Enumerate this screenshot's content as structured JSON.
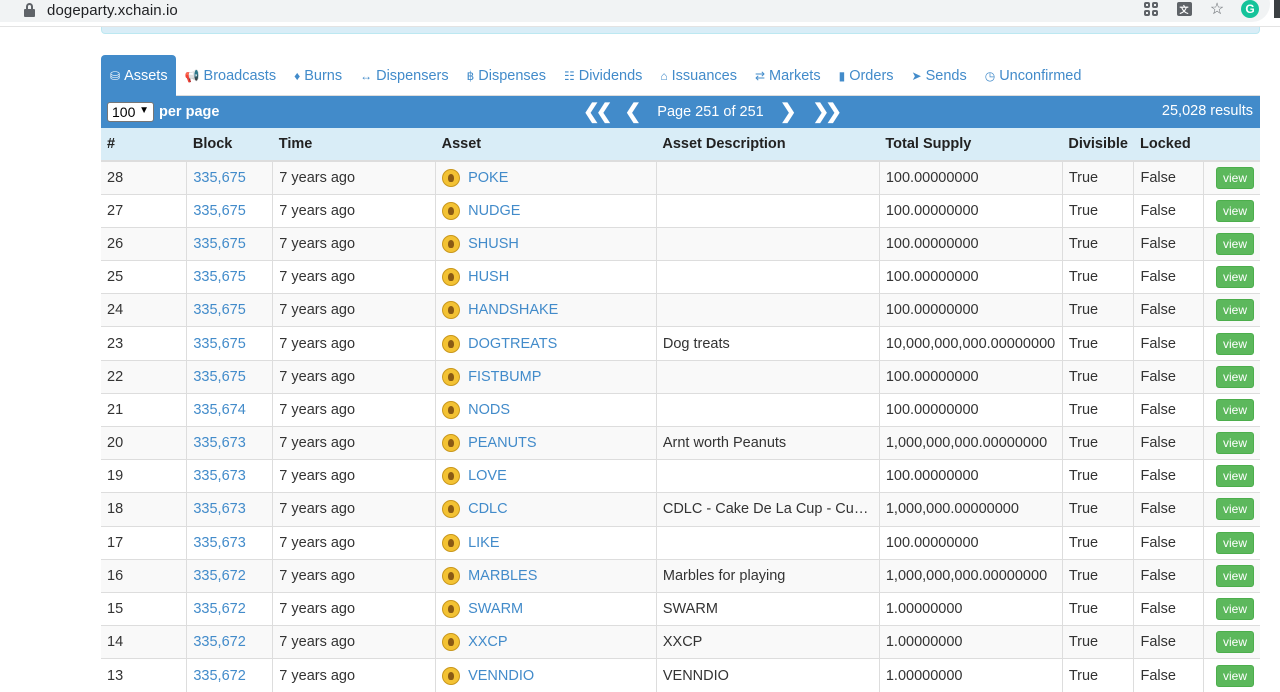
{
  "browser": {
    "url": "dogeparty.xchain.io",
    "icons": [
      "apps-icon",
      "translate-icon",
      "star-icon",
      "grammarly-icon"
    ]
  },
  "tabs": [
    {
      "label": "Assets",
      "icon": "coins-icon",
      "active": true
    },
    {
      "label": "Broadcasts",
      "icon": "bullhorn-icon"
    },
    {
      "label": "Burns",
      "icon": "fire-icon"
    },
    {
      "label": "Dispensers",
      "icon": "arrows-h-icon"
    },
    {
      "label": "Dispenses",
      "icon": "bitcoin-icon"
    },
    {
      "label": "Dividends",
      "icon": "sitemap-icon"
    },
    {
      "label": "Issuances",
      "icon": "bank-icon"
    },
    {
      "label": "Markets",
      "icon": "exchange-icon"
    },
    {
      "label": "Orders",
      "icon": "book-icon"
    },
    {
      "label": "Sends",
      "icon": "paper-plane-icon"
    },
    {
      "label": "Unconfirmed",
      "icon": "clock-icon"
    }
  ],
  "toolbar": {
    "per_page_value": "100",
    "per_page_label": "per page",
    "page_text": "Page 251 of 251",
    "results": "25,028 results"
  },
  "table": {
    "headers": [
      "#",
      "Block",
      "Time",
      "Asset",
      "Asset Description",
      "Total Supply",
      "Divisible",
      "Locked",
      ""
    ],
    "view_label": "view",
    "rows": [
      {
        "num": "28",
        "block": "335,675",
        "time": "7 years ago",
        "asset": "POKE",
        "desc": "",
        "supply": "100.00000000",
        "divisible": "True",
        "locked": "False"
      },
      {
        "num": "27",
        "block": "335,675",
        "time": "7 years ago",
        "asset": "NUDGE",
        "desc": "",
        "supply": "100.00000000",
        "divisible": "True",
        "locked": "False"
      },
      {
        "num": "26",
        "block": "335,675",
        "time": "7 years ago",
        "asset": "SHUSH",
        "desc": "",
        "supply": "100.00000000",
        "divisible": "True",
        "locked": "False"
      },
      {
        "num": "25",
        "block": "335,675",
        "time": "7 years ago",
        "asset": "HUSH",
        "desc": "",
        "supply": "100.00000000",
        "divisible": "True",
        "locked": "False"
      },
      {
        "num": "24",
        "block": "335,675",
        "time": "7 years ago",
        "asset": "HANDSHAKE",
        "desc": "",
        "supply": "100.00000000",
        "divisible": "True",
        "locked": "False"
      },
      {
        "num": "23",
        "block": "335,675",
        "time": "7 years ago",
        "asset": "DOGTREATS",
        "desc": "Dog treats",
        "supply": "10,000,000,000.00000000",
        "divisible": "True",
        "locked": "False"
      },
      {
        "num": "22",
        "block": "335,675",
        "time": "7 years ago",
        "asset": "FISTBUMP",
        "desc": "",
        "supply": "100.00000000",
        "divisible": "True",
        "locked": "False"
      },
      {
        "num": "21",
        "block": "335,674",
        "time": "7 years ago",
        "asset": "NODS",
        "desc": "",
        "supply": "100.00000000",
        "divisible": "True",
        "locked": "False"
      },
      {
        "num": "20",
        "block": "335,673",
        "time": "7 years ago",
        "asset": "PEANUTS",
        "desc": "Arnt worth Peanuts",
        "supply": "1,000,000,000.00000000",
        "divisible": "True",
        "locked": "False"
      },
      {
        "num": "19",
        "block": "335,673",
        "time": "7 years ago",
        "asset": "LOVE",
        "desc": "",
        "supply": "100.00000000",
        "divisible": "True",
        "locked": "False"
      },
      {
        "num": "18",
        "block": "335,673",
        "time": "7 years ago",
        "asset": "CDLC",
        "desc": "CDLC - Cake De La Cup - Cup…",
        "supply": "1,000,000.00000000",
        "divisible": "True",
        "locked": "False"
      },
      {
        "num": "17",
        "block": "335,673",
        "time": "7 years ago",
        "asset": "LIKE",
        "desc": "",
        "supply": "100.00000000",
        "divisible": "True",
        "locked": "False"
      },
      {
        "num": "16",
        "block": "335,672",
        "time": "7 years ago",
        "asset": "MARBLES",
        "desc": "Marbles for playing",
        "supply": "1,000,000,000.00000000",
        "divisible": "True",
        "locked": "False"
      },
      {
        "num": "15",
        "block": "335,672",
        "time": "7 years ago",
        "asset": "SWARM",
        "desc": "SWARM",
        "supply": "1.00000000",
        "divisible": "True",
        "locked": "False"
      },
      {
        "num": "14",
        "block": "335,672",
        "time": "7 years ago",
        "asset": "XXCP",
        "desc": "XXCP",
        "supply": "1.00000000",
        "divisible": "True",
        "locked": "False"
      },
      {
        "num": "13",
        "block": "335,672",
        "time": "7 years ago",
        "asset": "VENNDIO",
        "desc": "VENNDIO",
        "supply": "1.00000000",
        "divisible": "True",
        "locked": "False"
      }
    ]
  }
}
